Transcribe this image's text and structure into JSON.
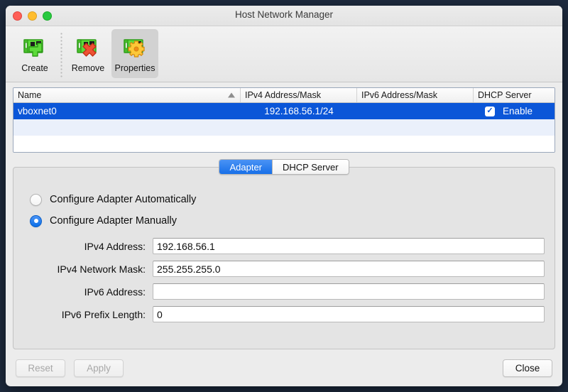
{
  "window": {
    "title": "Host Network Manager"
  },
  "traffic_lights": {
    "close": "close-button",
    "minimize": "minimize-button",
    "maximize": "maximize-button"
  },
  "toolbar": {
    "items": [
      {
        "label": "Create",
        "icon": "network-card-add-icon",
        "state": "enabled"
      },
      {
        "label": "Remove",
        "icon": "network-card-remove-icon",
        "state": "enabled"
      },
      {
        "label": "Properties",
        "icon": "network-card-gear-icon",
        "state": "pressed"
      }
    ]
  },
  "table": {
    "columns": [
      {
        "label": "Name",
        "sorted": "ascending"
      },
      {
        "label": "IPv4 Address/Mask",
        "sorted": ""
      },
      {
        "label": "IPv6 Address/Mask",
        "sorted": ""
      },
      {
        "label": "DHCP Server",
        "sorted": ""
      }
    ],
    "rows": [
      {
        "name": "vboxnet0",
        "ipv4": "192.168.56.1/24",
        "ipv6": "",
        "dhcp_checked": true,
        "dhcp_label": "Enable",
        "selected": true
      }
    ]
  },
  "tabs": [
    {
      "label": "Adapter",
      "active": true
    },
    {
      "label": "DHCP Server",
      "active": false
    }
  ],
  "adapter": {
    "radio_auto": {
      "label": "Configure Adapter Automatically",
      "selected": false
    },
    "radio_manual": {
      "label": "Configure Adapter Manually",
      "selected": true
    },
    "fields": [
      {
        "label": "IPv4 Address:",
        "value": "192.168.56.1"
      },
      {
        "label": "IPv4 Network Mask:",
        "value": "255.255.255.0"
      },
      {
        "label": "IPv6 Address:",
        "value": ""
      },
      {
        "label": "IPv6 Prefix Length:",
        "value": "0"
      }
    ]
  },
  "footer": {
    "reset": {
      "label": "Reset",
      "enabled": false
    },
    "apply": {
      "label": "Apply",
      "enabled": false
    },
    "close": {
      "label": "Close",
      "enabled": true
    }
  },
  "colors": {
    "desktop": "#1e2b3f",
    "accent_blue": "#0b56d8",
    "tab_blue": "#176fe8",
    "selection_row": "#0b56d8",
    "stripe_row": "#eaf0fb",
    "window_bg": "#ececec"
  }
}
